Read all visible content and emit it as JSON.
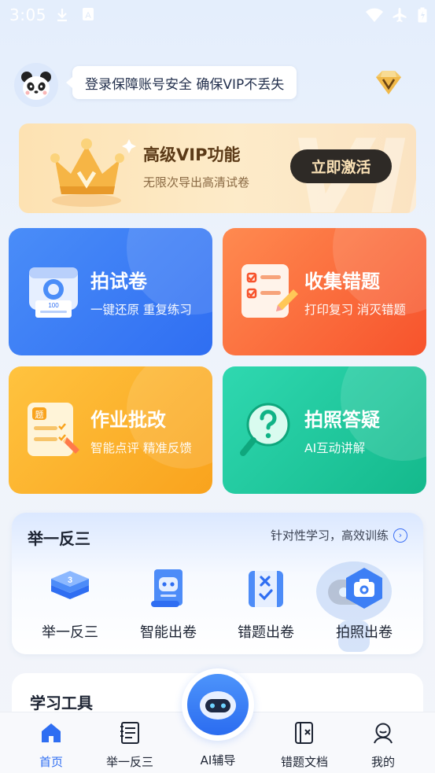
{
  "status_bar": {
    "time": "3:05"
  },
  "user": {
    "notice": "登录保障账号安全 确保VIP不丢失"
  },
  "vip_banner": {
    "title": "高级VIP功能",
    "subtitle": "无限次导出高清试卷",
    "button": "立即激活",
    "watermark": "VIP"
  },
  "cards": [
    {
      "title": "拍试卷",
      "subtitle": "一键还原  重复练习"
    },
    {
      "title": "收集错题",
      "subtitle": "打印复习  消灭错题"
    },
    {
      "title": "作业批改",
      "subtitle": "智能点评  精准反馈"
    },
    {
      "title": "拍照答疑",
      "subtitle": "AI互动讲解"
    }
  ],
  "practice": {
    "title": "举一反三",
    "link": "针对性学习，高效训练",
    "tools": [
      {
        "label": "举一反三"
      },
      {
        "label": "智能出卷"
      },
      {
        "label": "错题出卷"
      },
      {
        "label": "拍照出卷"
      }
    ]
  },
  "study_tools": {
    "title": "学习工具"
  },
  "nav": [
    {
      "label": "首页"
    },
    {
      "label": "举一反三"
    },
    {
      "label": "AI辅导"
    },
    {
      "label": "错题文档"
    },
    {
      "label": "我的"
    }
  ],
  "colors": {
    "primary": "#2f6ef2",
    "card_blue": "#3d7ff5",
    "card_orange": "#f86a3a",
    "card_yellow": "#fbb22e",
    "card_green": "#1fc79b",
    "vip_gold": "#fde2b2"
  },
  "icons": {
    "status": [
      "download-icon",
      "keyboard-icon",
      "wifi-icon",
      "airplane-icon",
      "battery-icon"
    ],
    "nav": [
      "home-icon",
      "list-book-icon",
      "ai-robot-icon",
      "document-x-icon",
      "profile-icon"
    ]
  }
}
